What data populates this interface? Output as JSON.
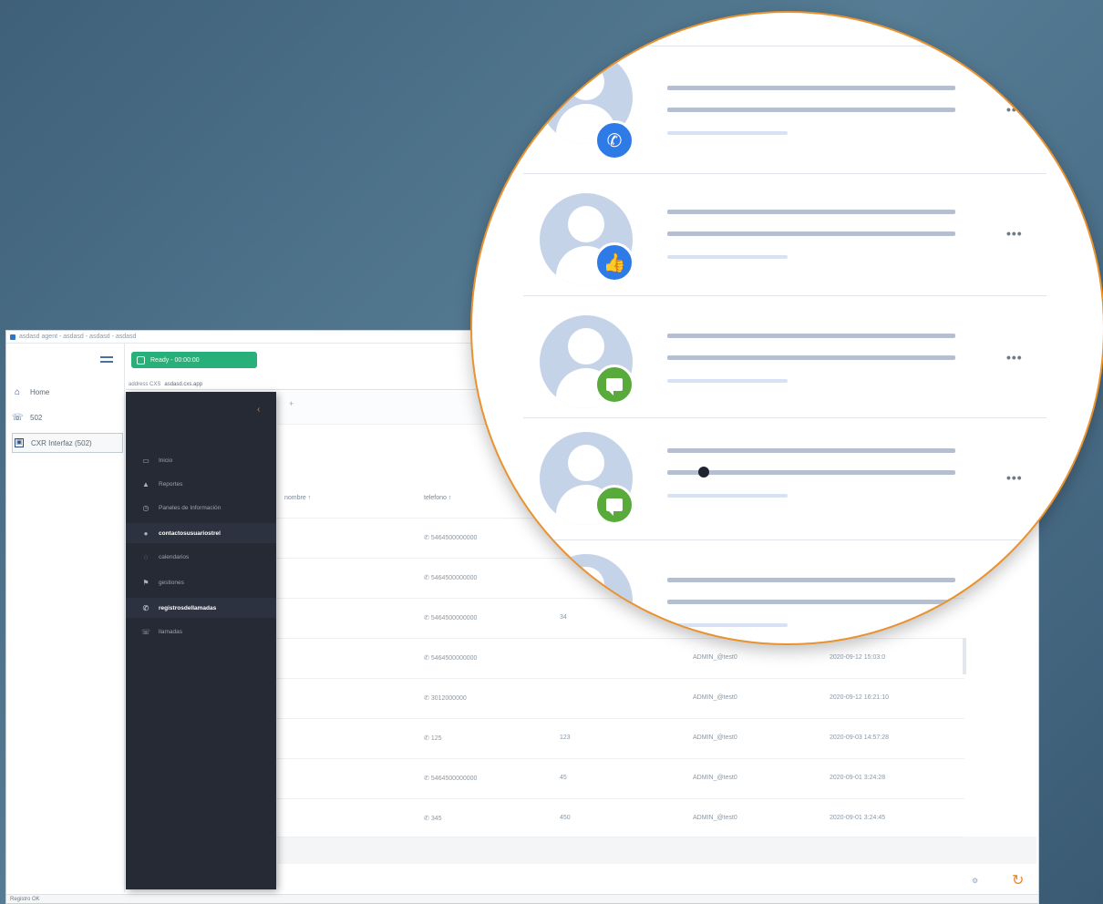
{
  "window": {
    "title": "asdasd agent - asdasd - asdasd - asdasd",
    "status": "Registro OK"
  },
  "left_nav": [
    {
      "label": "Home",
      "icon": "home-icon"
    },
    {
      "label": "502",
      "icon": "phone-icon"
    },
    {
      "label": "CXR Interfaz (502)",
      "icon": "contact-card-icon"
    }
  ],
  "agent_state": {
    "label": "Ready - 00:00:00"
  },
  "url": {
    "prefix": "address CXS",
    "value": "asdasd.cxs.app"
  },
  "menu": {
    "items": [
      {
        "label": "Inicio",
        "icon": "calendar-icon",
        "bold": false
      },
      {
        "label": "Reportes",
        "icon": "bar-chart-icon",
        "bold": false
      },
      {
        "label": "Paneles de Información",
        "icon": "clock-icon",
        "bold": false
      },
      {
        "label": "contactosusuariostrel",
        "icon": "user-icon",
        "bold": true
      },
      {
        "label": "calendarios",
        "icon": "globe-icon",
        "bold": false
      },
      {
        "label": "gestiones",
        "icon": "flag-icon",
        "bold": false
      },
      {
        "label": "registrosdellamadas",
        "icon": "phone-icon",
        "bold": true
      },
      {
        "label": "llamadas",
        "icon": "phone-list-icon",
        "bold": false
      }
    ]
  },
  "table": {
    "columns": [
      "nombre",
      "telefono"
    ],
    "rows": [
      {
        "phone": "5464500000000",
        "count": "",
        "user": "",
        "date": ""
      },
      {
        "phone": "5464500000000",
        "count": "",
        "user": "",
        "date": ""
      },
      {
        "phone": "5464500000000",
        "count": "34",
        "user": "",
        "date": ""
      },
      {
        "phone": "5464500000000",
        "count": "",
        "user": "ADMIN_@test0",
        "date": "2020-09-12 15:03:0"
      },
      {
        "phone": "3012000000",
        "count": "",
        "user": "ADMIN_@test0",
        "date": "2020-09-12 16:21:10"
      },
      {
        "phone": "125",
        "count": "123",
        "user": "ADMIN_@test0",
        "date": "2020-09-03 14:57:28"
      },
      {
        "phone": "5464500000000",
        "count": "45",
        "user": "ADMIN_@test0",
        "date": "2020-09-01 3:24:28"
      },
      {
        "phone": "345",
        "count": "450",
        "user": "ADMIN_@test0",
        "date": "2020-09-01 3:24:45"
      }
    ]
  },
  "magnifier": {
    "items": [
      {
        "badge": "phone",
        "badge_color": "#2e7be8",
        "badge_icon": "phone-icon"
      },
      {
        "badge": "like",
        "badge_color": "#2e7be8",
        "badge_icon": "thumbs-up-icon"
      },
      {
        "badge": "chat",
        "badge_color": "#58ab3a",
        "badge_icon": "chat-icon"
      },
      {
        "badge": "chat",
        "badge_color": "#58ab3a",
        "badge_icon": "chat-icon"
      },
      {
        "badge": "none",
        "badge_color": "",
        "badge_icon": ""
      }
    ],
    "more_glyph": "•••"
  },
  "colors": {
    "accent": "#e8892a",
    "ready_green": "#27b07a",
    "menu_dark": "#262a35",
    "avatar": "#c5d3e8"
  }
}
